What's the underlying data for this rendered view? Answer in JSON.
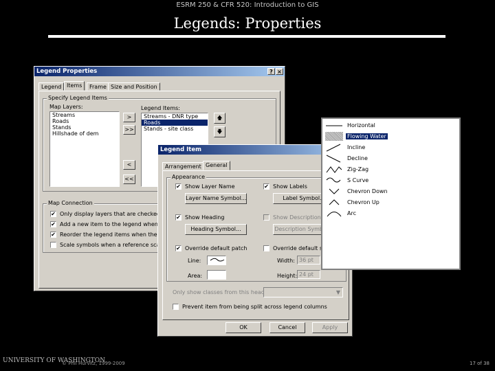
{
  "slide": {
    "course": "ESRM 250 & CFR 520: Introduction to GIS",
    "title": "Legends: Properties",
    "uw": "UNIVERSITY OF WASHINGTON",
    "copyright": "© Phil Hurvitz, 1999-2009",
    "page": "17 of 38"
  },
  "legend_props": {
    "title": "Legend Properties",
    "help": "?",
    "close": "×",
    "tabs": [
      "Legend",
      "Items",
      "Frame",
      "Size and Position"
    ],
    "group_specify": "Specify Legend Items",
    "map_layers_label": "Map Layers:",
    "map_layers": [
      "Streams",
      "Roads",
      "Stands",
      "Hillshade of dem"
    ],
    "legend_items_label": "Legend Items:",
    "legend_items": [
      "Streams - DNR type",
      "Roads",
      "Stands - site class"
    ],
    "btn_add": ">",
    "btn_add_all": ">>",
    "btn_remove": "<",
    "btn_remove_all": "<<",
    "arrow_up": "🡅",
    "arrow_down": "🡇",
    "group_map_conn": "Map Connection",
    "map_conn": [
      {
        "label": "Only display layers that are checked on i",
        "checked": "✔"
      },
      {
        "label": "Add a new item to the legend when a ne",
        "checked": "✔"
      },
      {
        "label": "Reorder the legend items when the map",
        "checked": "✔"
      },
      {
        "label": "Scale symbols when a reference scale is",
        "checked": ""
      }
    ]
  },
  "legend_item": {
    "title": "Legend Item",
    "tabs": [
      "Arrangement",
      "General"
    ],
    "group_appearance": "Appearance",
    "show_layer_name": "Show Layer Name",
    "show_layer_name_checked": "✔",
    "layer_name_symbol": "Layer Name Symbol...",
    "show_labels": "Show Labels",
    "show_labels_checked": "✔",
    "label_symbol": "Label Symbol...",
    "show_heading": "Show Heading",
    "show_heading_checked": "✔",
    "heading_symbol": "Heading Symbol...",
    "show_descriptions": "Show Descriptions",
    "description_symbol": "Description Symbol...",
    "override_patch": "Override default patch",
    "override_patch_checked": "✔",
    "line_label": "Line:",
    "area_label": "Area:",
    "override_size": "Override default size",
    "width_label": "Width:",
    "width_value": "36 pt",
    "height_label": "Height:",
    "height_value": "24 pt",
    "only_show_classes": "Only show classes from this heading:",
    "prevent_split": "Prevent item from being split across legend columns",
    "ok": "OK",
    "cancel": "Cancel",
    "apply": "Apply"
  },
  "patch_list": {
    "items": [
      "Horizontal",
      "Flowing Water",
      "Incline",
      "Decline",
      "Zig-Zag",
      "S Curve",
      "Chevron Down",
      "Chevron Up",
      "Arc"
    ],
    "selected_index": 1
  }
}
